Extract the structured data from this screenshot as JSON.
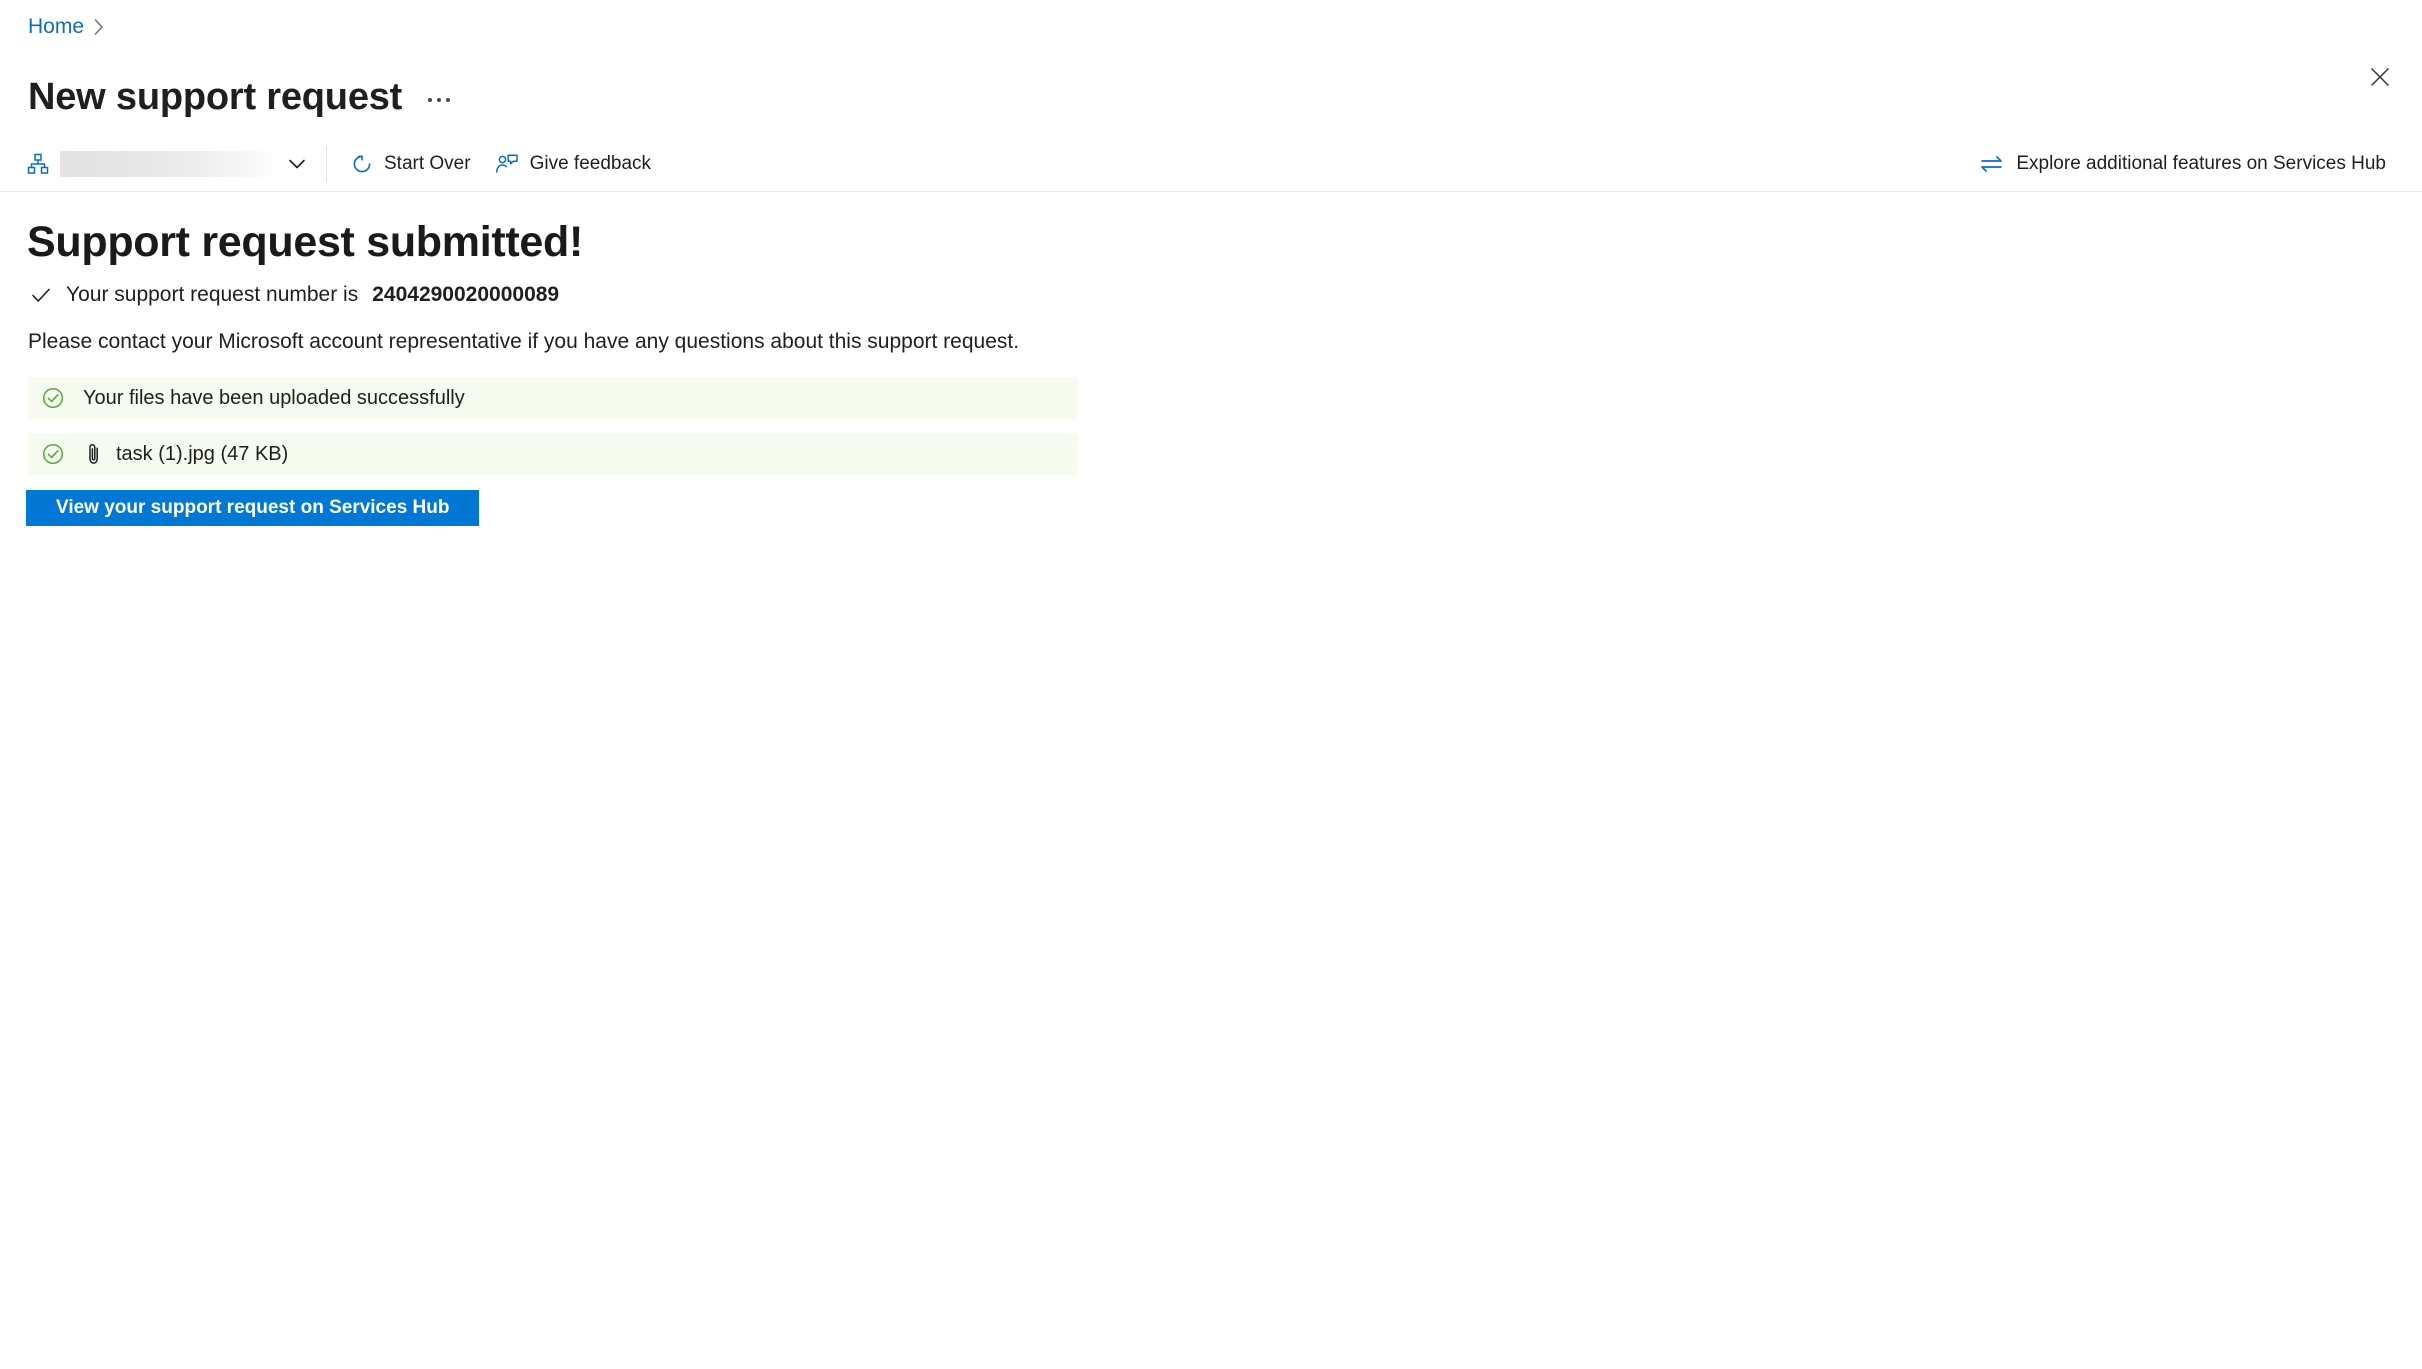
{
  "breadcrumb": {
    "home_label": "Home",
    "chevron_icon": "chevron-right-icon"
  },
  "header": {
    "title": "New support request",
    "more_options_icon": "ellipsis-icon",
    "close_icon": "close-icon"
  },
  "toolbar": {
    "scope_picker": {
      "icon": "hierarchy-icon",
      "value": "",
      "chevron_icon": "chevron-down-icon"
    },
    "start_over_label": "Start Over",
    "start_over_icon": "refresh-icon",
    "give_feedback_label": "Give feedback",
    "give_feedback_icon": "person-feedback-icon",
    "explore_label": "Explore additional features on Services Hub",
    "explore_icon": "transfer-arrows-icon"
  },
  "main": {
    "heading": "Support request submitted!",
    "request_check_icon": "checkmark-icon",
    "request_prefix": "Your support request number is",
    "request_number": "2404290020000089",
    "contact_text": "Please contact your Microsoft account representative if you have any questions about this support request.",
    "status_items": [
      {
        "icon": "check-circle-icon",
        "text": "Your files have been uploaded successfully"
      },
      {
        "icon": "check-circle-icon",
        "attachment_icon": "paperclip-icon",
        "text": "task (1).jpg (47 KB)"
      }
    ],
    "primary_button_label": "View your support request on Services Hub"
  },
  "colors": {
    "link": "#0f6cbd",
    "accent": "#0078d4",
    "success_green": "#5ba73c",
    "success_bg": "#f5fbef",
    "text": "#201f1e"
  }
}
